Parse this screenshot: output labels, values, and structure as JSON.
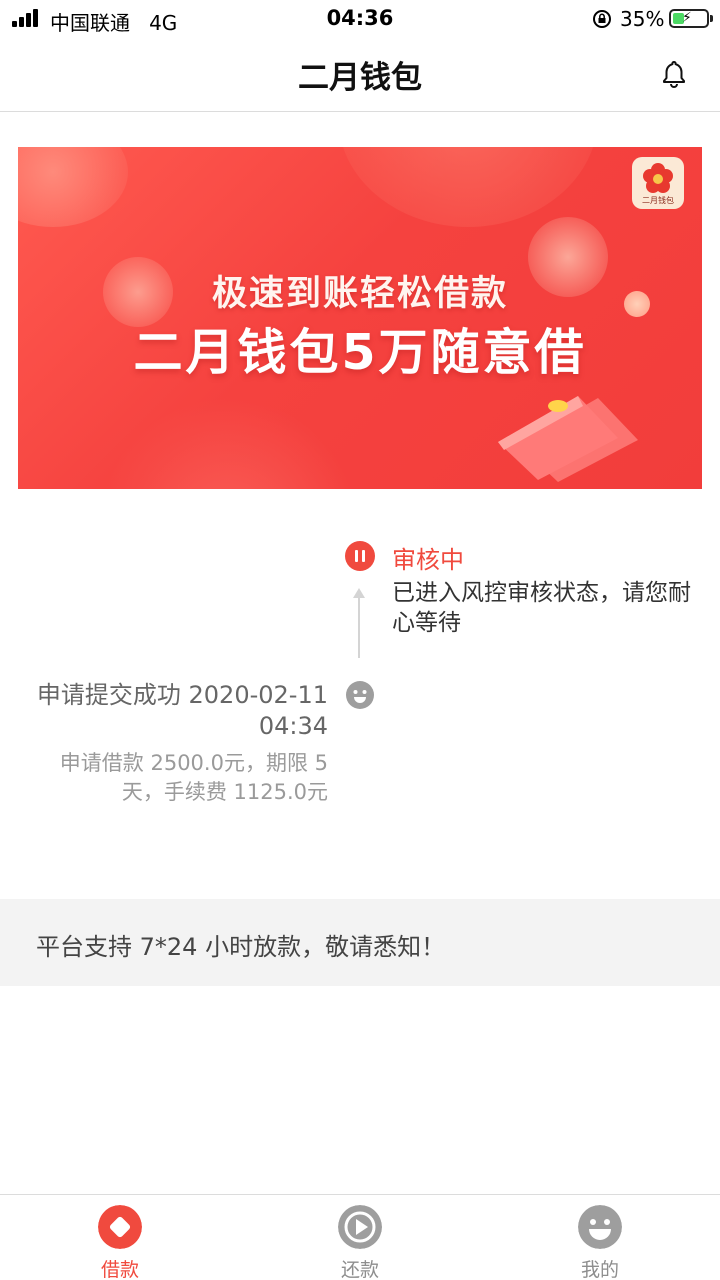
{
  "status_bar": {
    "carrier": "中国联通",
    "network": "4G",
    "time": "04:36",
    "battery_percent": "35%",
    "battery_level": 0.35,
    "battery_color": "#4cd964"
  },
  "header": {
    "title": "二月钱包",
    "right_icon": "bell-icon"
  },
  "banner": {
    "line1": "极速到账轻松借款",
    "line2": "二月钱包5万随意借",
    "logo_text": "二月钱包",
    "background": "#f5423f"
  },
  "timeline": {
    "current_status": {
      "icon": "pause-icon",
      "title": "审核中",
      "description": "已进入风控审核状态，请您耐心等待",
      "color": "#f04a3e"
    },
    "submitted": {
      "icon": "smiley-icon",
      "title": "申请提交成功 2020-02-11 04:34",
      "description": "申请借款 2500.0元，期限 5天，手续费 1125.0元"
    }
  },
  "notice": {
    "text": "平台支持 7*24 小时放款，敬请悉知！"
  },
  "tabbar": {
    "active_color": "#f04a3e",
    "inactive_color": "#8e8e8e",
    "items": [
      {
        "label": "借款",
        "icon": "diamond-icon",
        "active": true
      },
      {
        "label": "还款",
        "icon": "play-icon",
        "active": false
      },
      {
        "label": "我的",
        "icon": "smiley-icon",
        "active": false
      }
    ]
  }
}
